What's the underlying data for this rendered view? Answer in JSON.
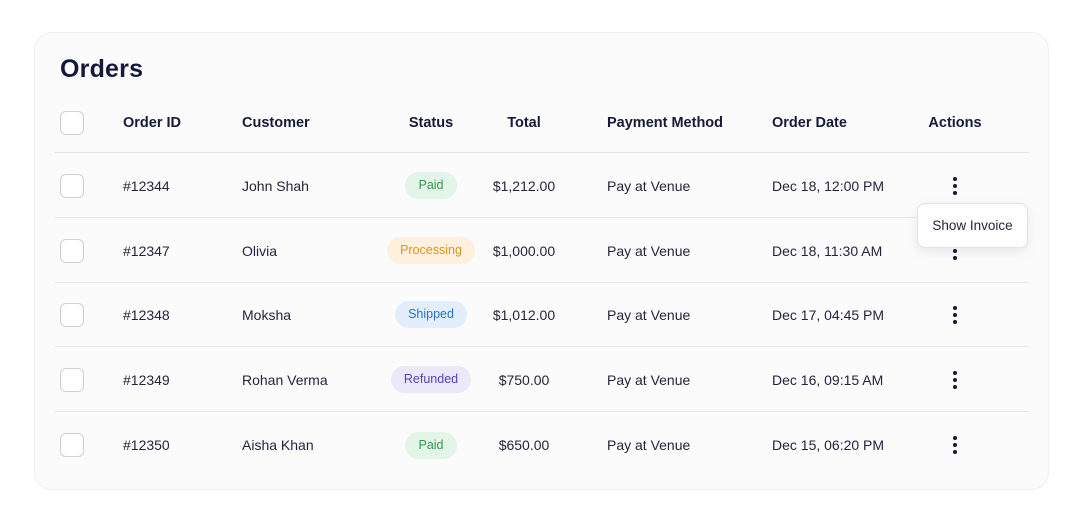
{
  "title": "Orders",
  "columns": {
    "order_id": "Order ID",
    "customer": "Customer",
    "status": "Status",
    "total": "Total",
    "payment_method": "Payment Method",
    "order_date": "Order Date",
    "actions": "Actions"
  },
  "orders": [
    {
      "id": "#12344",
      "customer": "John Shah",
      "status": "Paid",
      "status_bg": "#e3f4e8",
      "status_fg": "#2f9a4e",
      "total": "$1,212.00",
      "payment": "Pay at Venue",
      "date": "Dec 18, 12:00 PM"
    },
    {
      "id": "#12347",
      "customer": "Olivia",
      "status": "Processing",
      "status_bg": "#fdf1dd",
      "status_fg": "#d99420",
      "total": "$1,000.00",
      "payment": "Pay at Venue",
      "date": "Dec 18, 11:30 AM"
    },
    {
      "id": "#12348",
      "customer": "Moksha",
      "status": "Shipped",
      "status_bg": "#e2eefb",
      "status_fg": "#2f6fc4",
      "total": "$1,012.00",
      "payment": "Pay at Venue",
      "date": "Dec 17, 04:45 PM"
    },
    {
      "id": "#12349",
      "customer": "Rohan Verma",
      "status": "Refunded",
      "status_bg": "#ebe8fa",
      "status_fg": "#5443b8",
      "total": "$750.00",
      "payment": "Pay at Venue",
      "date": "Dec 16, 09:15 AM"
    },
    {
      "id": "#12350",
      "customer": "Aisha Khan",
      "status": "Paid",
      "status_bg": "#e3f4e8",
      "status_fg": "#2f9a4e",
      "total": "$650.00",
      "payment": "Pay at Venue",
      "date": "Dec 15, 06:20 PM"
    }
  ],
  "popover": {
    "label": "Show Invoice"
  }
}
